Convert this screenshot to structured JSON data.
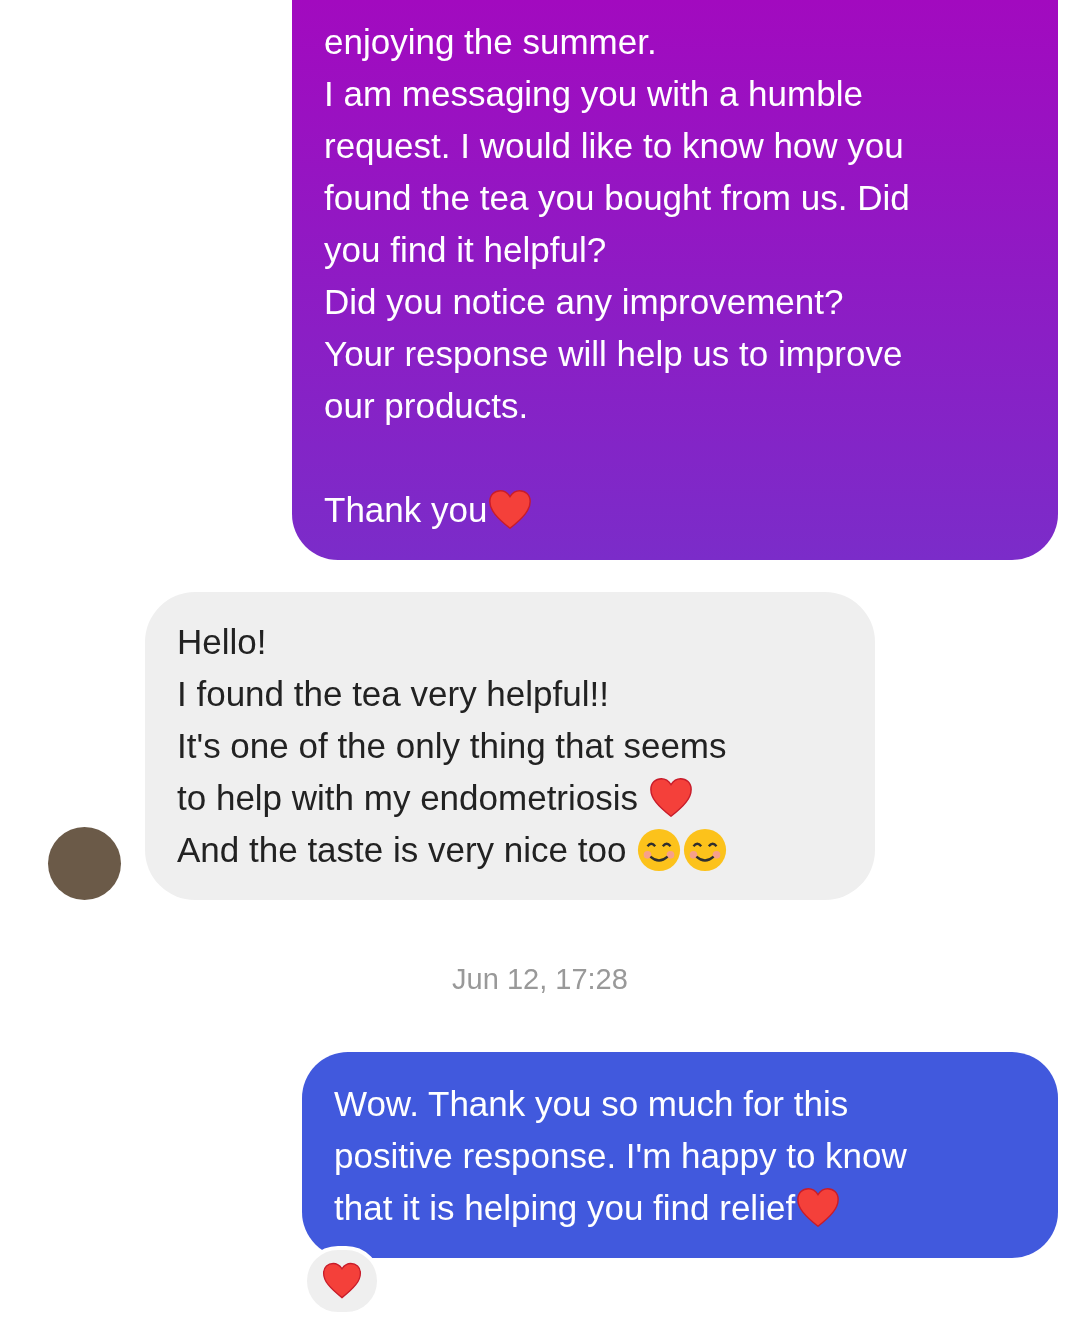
{
  "messages": [
    {
      "kind": "sent_gradient",
      "paragraphs": [
        [
          {
            "parts": [
              {
                "kind": "text",
                "text": "enjoying the summer."
              }
            ]
          },
          {
            "parts": [
              {
                "kind": "text",
                "text": "I am messaging you with a humble"
              }
            ]
          },
          {
            "parts": [
              {
                "kind": "text",
                "text": "request. I would like to know how you"
              }
            ]
          },
          {
            "parts": [
              {
                "kind": "text",
                "text": "found the tea you bought from us. Did"
              }
            ]
          },
          {
            "parts": [
              {
                "kind": "text",
                "text": "you find it helpful?"
              }
            ]
          },
          {
            "parts": [
              {
                "kind": "text",
                "text": "Did you notice any improvement?"
              }
            ]
          },
          {
            "parts": [
              {
                "kind": "text",
                "text": "Your response will help us to improve"
              }
            ]
          },
          {
            "parts": [
              {
                "kind": "text",
                "text": "our products."
              }
            ]
          }
        ],
        [
          {
            "parts": [
              {
                "kind": "text",
                "text": "Thank you"
              },
              {
                "kind": "heart"
              }
            ]
          }
        ]
      ]
    },
    {
      "kind": "received",
      "avatar": true,
      "paragraphs": [
        [
          {
            "parts": [
              {
                "kind": "text",
                "text": "Hello!"
              }
            ]
          },
          {
            "parts": [
              {
                "kind": "text",
                "text": "I found the tea very helpful!!"
              }
            ]
          },
          {
            "parts": [
              {
                "kind": "text",
                "text": "It's one of the only thing that seems"
              }
            ]
          },
          {
            "parts": [
              {
                "kind": "text",
                "text": "to help with my endometriosis "
              },
              {
                "kind": "heart"
              }
            ]
          },
          {
            "parts": [
              {
                "kind": "text",
                "text": "And the taste is very nice too "
              },
              {
                "kind": "smile"
              },
              {
                "kind": "smile"
              }
            ]
          }
        ]
      ]
    },
    {
      "kind": "timestamp",
      "text": "Jun 12, 17:28"
    },
    {
      "kind": "sent_solid",
      "paragraphs": [
        [
          {
            "parts": [
              {
                "kind": "text",
                "text": "Wow. Thank you so much for this"
              }
            ]
          },
          {
            "parts": [
              {
                "kind": "text",
                "text": "positive response. I'm happy to know"
              }
            ]
          },
          {
            "parts": [
              {
                "kind": "text",
                "text": "that it is helping you find relief"
              },
              {
                "kind": "heart"
              }
            ]
          }
        ]
      ],
      "reactions": [
        {
          "kind": "heart"
        }
      ]
    }
  ]
}
